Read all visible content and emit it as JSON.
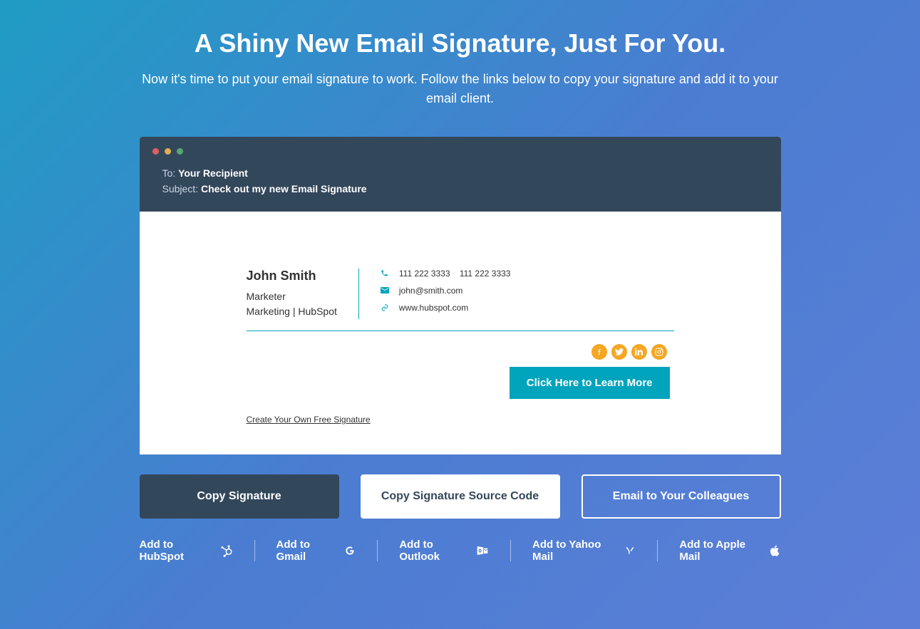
{
  "page": {
    "title": "A Shiny New Email Signature, Just For You.",
    "subtitle": "Now it's time to put your email signature to work. Follow the links below to copy your signature and add it to your email client."
  },
  "email": {
    "to_label": "To: ",
    "to_value": "Your Recipient",
    "subject_label": "Subject: ",
    "subject_value": "Check out my new Email Signature"
  },
  "signature": {
    "name": "John Smith",
    "title": "Marketer",
    "department": "Marketing | HubSpot",
    "phone1": "111 222 3333",
    "phone2": "111 222 3333",
    "email": "john@smith.com",
    "website": "www.hubspot.com",
    "cta": "Click Here to Learn More",
    "create_link": "Create Your Own Free Signature"
  },
  "actions": {
    "copy": "Copy Signature",
    "copy_source": "Copy Signature Source Code",
    "email_colleagues": "Email to Your Colleagues"
  },
  "add_links": {
    "hubspot": "Add to HubSpot",
    "gmail": "Add to Gmail",
    "outlook": "Add to Outlook",
    "yahoo": "Add to Yahoo Mail",
    "apple": "Add to Apple Mail"
  }
}
